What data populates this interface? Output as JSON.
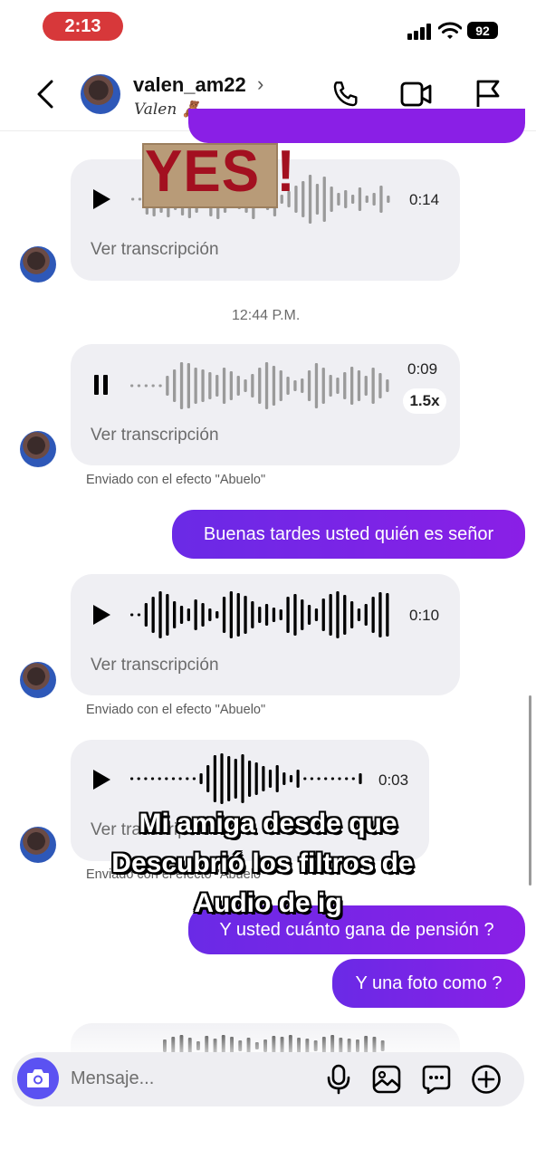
{
  "status": {
    "time": "2:13",
    "battery": "92"
  },
  "header": {
    "username": "valen_am22",
    "chevron": "›",
    "display_name": "Valen 🧸"
  },
  "overlay": {
    "sticker_text": "YES !",
    "caption_lines": [
      "Mi amiga desde que",
      "Descubrió los filtros de",
      "Audio de ig"
    ]
  },
  "messages": {
    "voice1": {
      "duration": "0:14",
      "transcript": "Ver transcripción"
    },
    "timestamp": "12:44 P.M.",
    "voice2": {
      "duration": "0:09",
      "speed": "1.5x",
      "transcript": "Ver transcripción",
      "note": "Enviado con el efecto \"Abuelo\""
    },
    "out1": "Buenas tardes usted quién es señor",
    "voice3": {
      "duration": "0:10",
      "transcript": "Ver transcripción",
      "note": "Enviado con el efecto \"Abuelo\""
    },
    "voice4": {
      "duration": "0:03",
      "transcript": "Ver transcripción",
      "note": "Enviado con el efecto \"Abuelo\""
    },
    "out2": "Y usted cuánto gana de pensión ?",
    "out3": "Y una foto como ?"
  },
  "composer": {
    "placeholder": "Mensaje..."
  }
}
